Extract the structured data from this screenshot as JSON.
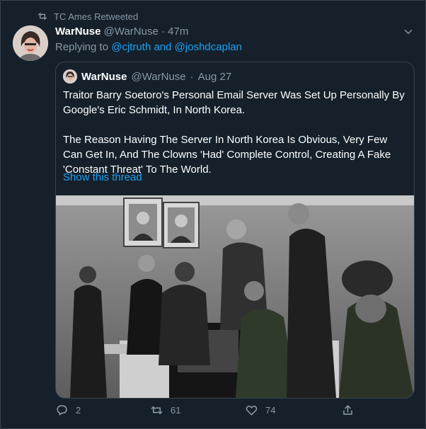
{
  "retweet": {
    "label": "TC Ames Retweeted"
  },
  "tweet": {
    "name": "WarNuse",
    "handle": "@WarNuse",
    "separator": "·",
    "time": "47m",
    "replying_prefix": "Replying to",
    "reply_user1": "@cjtruth",
    "reply_and": "and",
    "reply_user2": "@joshdcaplan"
  },
  "quote": {
    "name": "WarNuse",
    "handle": "@WarNuse",
    "separator": "·",
    "date": "Aug 27",
    "paragraph1": "Traitor Barry Soetoro's Personal Email Server Was Set Up Personally By Google's Eric Schmidt, In North Korea.",
    "paragraph2": "The Reason Having The Server In North Korea Is Obvious, Very Few Can Get In, And The Clowns 'Had' Complete Control, Creating A Fake 'Constant Threat' To The World.",
    "show_thread": "Show this thread"
  },
  "actions": {
    "reply_count": "2",
    "retweet_count": "61",
    "like_count": "74"
  },
  "icons": {
    "retweet": "retweet-icon",
    "reply": "reply-icon",
    "like": "heart-icon",
    "share": "share-icon",
    "more": "chevron-down-icon"
  },
  "colors": {
    "background": "#15202b",
    "secondary_text": "#8899a6",
    "accent": "#1da1f2",
    "border": "#38444d"
  }
}
